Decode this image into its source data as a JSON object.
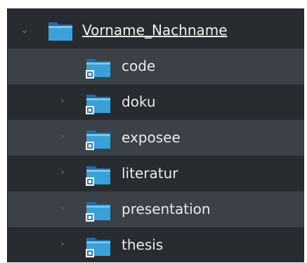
{
  "tree": {
    "root": {
      "label": "Vorname_Nachname",
      "expanded": true,
      "icon": "folder-icon"
    },
    "children": [
      {
        "label": "code",
        "expandable": false,
        "icon": "folder-link-icon"
      },
      {
        "label": "doku",
        "expandable": true,
        "icon": "folder-link-icon"
      },
      {
        "label": "exposee",
        "expandable": true,
        "icon": "folder-link-icon"
      },
      {
        "label": "literatur",
        "expandable": true,
        "icon": "folder-link-icon"
      },
      {
        "label": "presentation",
        "expandable": true,
        "icon": "folder-link-icon"
      },
      {
        "label": "thesis",
        "expandable": true,
        "icon": "folder-link-icon"
      }
    ],
    "colors": {
      "background": "#282c30",
      "row_alt": "#3c4147",
      "text": "#eaeaea",
      "folder": "#3aa0d8"
    }
  }
}
